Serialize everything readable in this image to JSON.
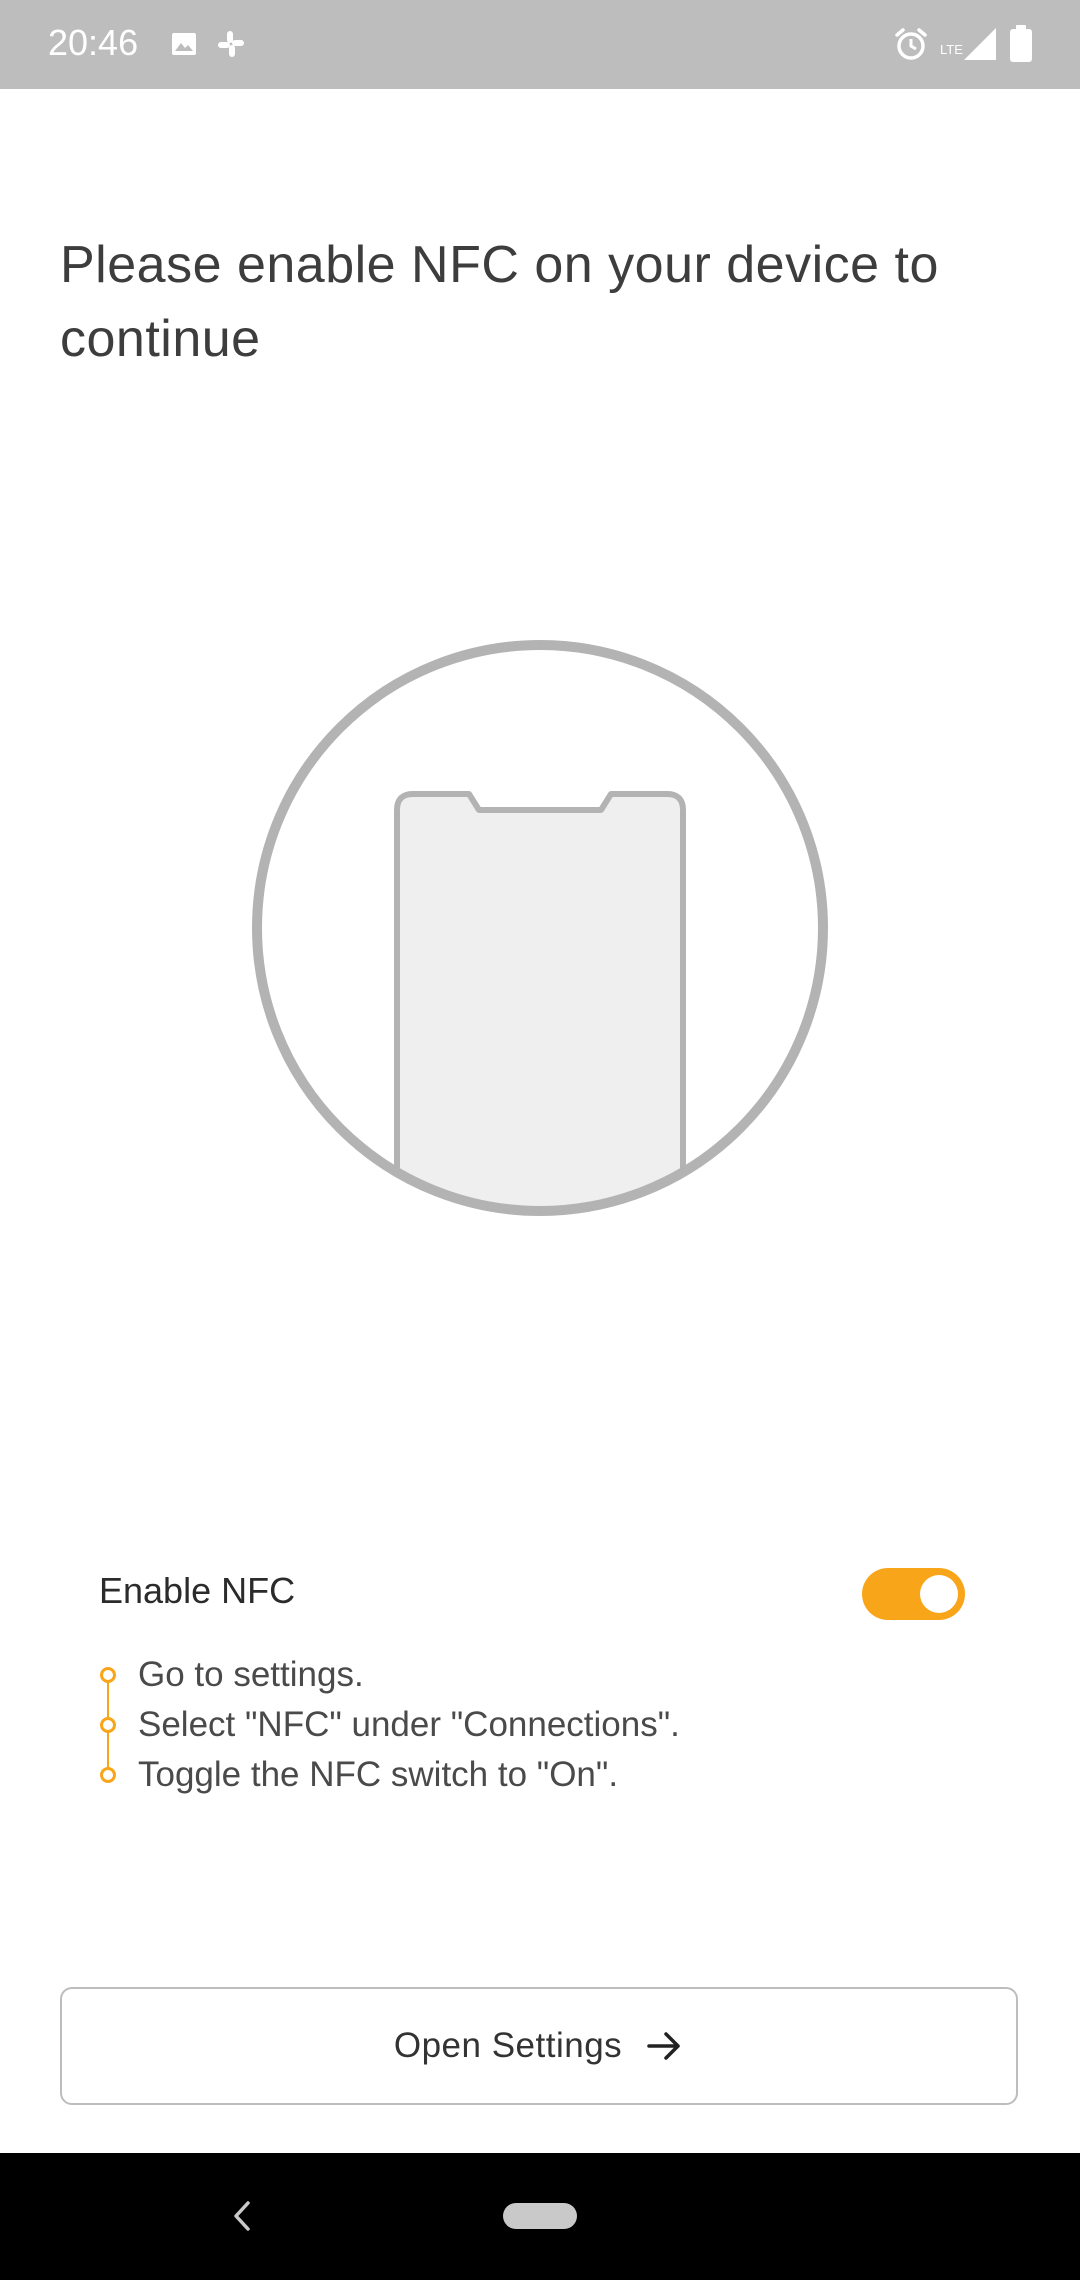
{
  "status_bar": {
    "time": "20:46",
    "network_label": "LTE",
    "icons": [
      "image-icon",
      "slack-icon",
      "alarm-icon",
      "signal-icon",
      "battery-icon"
    ]
  },
  "title": "Please enable NFC on your device to continue",
  "illustration": {
    "icon": "phone-in-circle-icon"
  },
  "nfc": {
    "label": "Enable NFC",
    "enabled": true,
    "accent_color": "#f9a51a"
  },
  "steps": [
    "Go to settings.",
    "Select \"NFC\" under \"Connections\".",
    "Toggle the NFC switch to \"On\"."
  ],
  "open_settings": {
    "label": "Open Settings",
    "icon": "arrow-right-icon"
  },
  "nav_bar": {
    "icons": [
      "back-icon",
      "home-pill-icon"
    ]
  }
}
